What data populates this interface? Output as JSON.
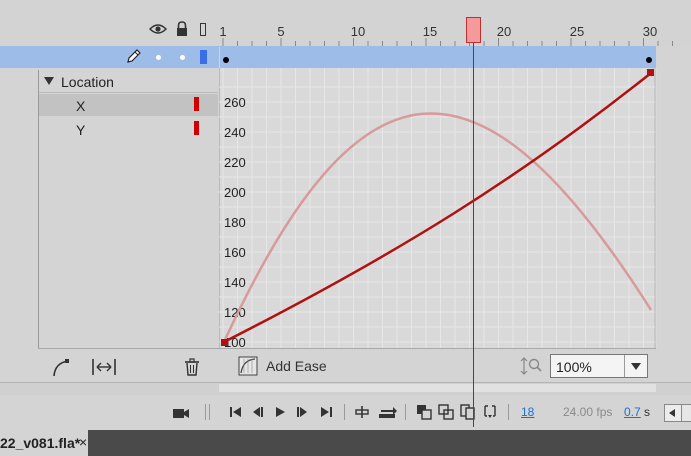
{
  "timeline_ruler": {
    "labels": [
      "1",
      "5",
      "10",
      "15",
      "20",
      "25",
      "30"
    ],
    "playhead_frame": 18,
    "last_frame": 30
  },
  "motion_editor": {
    "property_group": "Location",
    "properties": [
      {
        "label": "X",
        "swatch_color": "#cc0000"
      },
      {
        "label": "Y",
        "swatch_color": "#cc0000"
      }
    ],
    "graph": {
      "y_ticks": [
        "260",
        "240",
        "220",
        "200",
        "180",
        "160",
        "140",
        "120",
        "100"
      ],
      "x_curve_color": "#b01010",
      "y_curve_color": "#d89a9a"
    },
    "add_ease_label": "Add Ease",
    "zoom_value": "100%"
  },
  "controls": {
    "current_frame": "18",
    "fps": "24.00 fps",
    "elapsed_value": "0.7",
    "elapsed_unit": "s"
  },
  "document_tab": {
    "title": "22_v081.fla*",
    "close_glyph": "×"
  },
  "icons": [
    "eye-icon",
    "lock-icon",
    "outline-icon",
    "pencil-icon",
    "ease-curve-icon",
    "fit-width-icon",
    "trash-icon",
    "add-ease-icon",
    "vertical-zoom-icon",
    "camera-icon",
    "go-first-icon",
    "step-back-icon",
    "play-icon",
    "step-forward-icon",
    "go-last-icon",
    "loop-icon",
    "onion-skin-icon",
    "onion-outline-icon",
    "edit-multiple-icon",
    "marker-icon",
    "scroll-left-icon"
  ]
}
